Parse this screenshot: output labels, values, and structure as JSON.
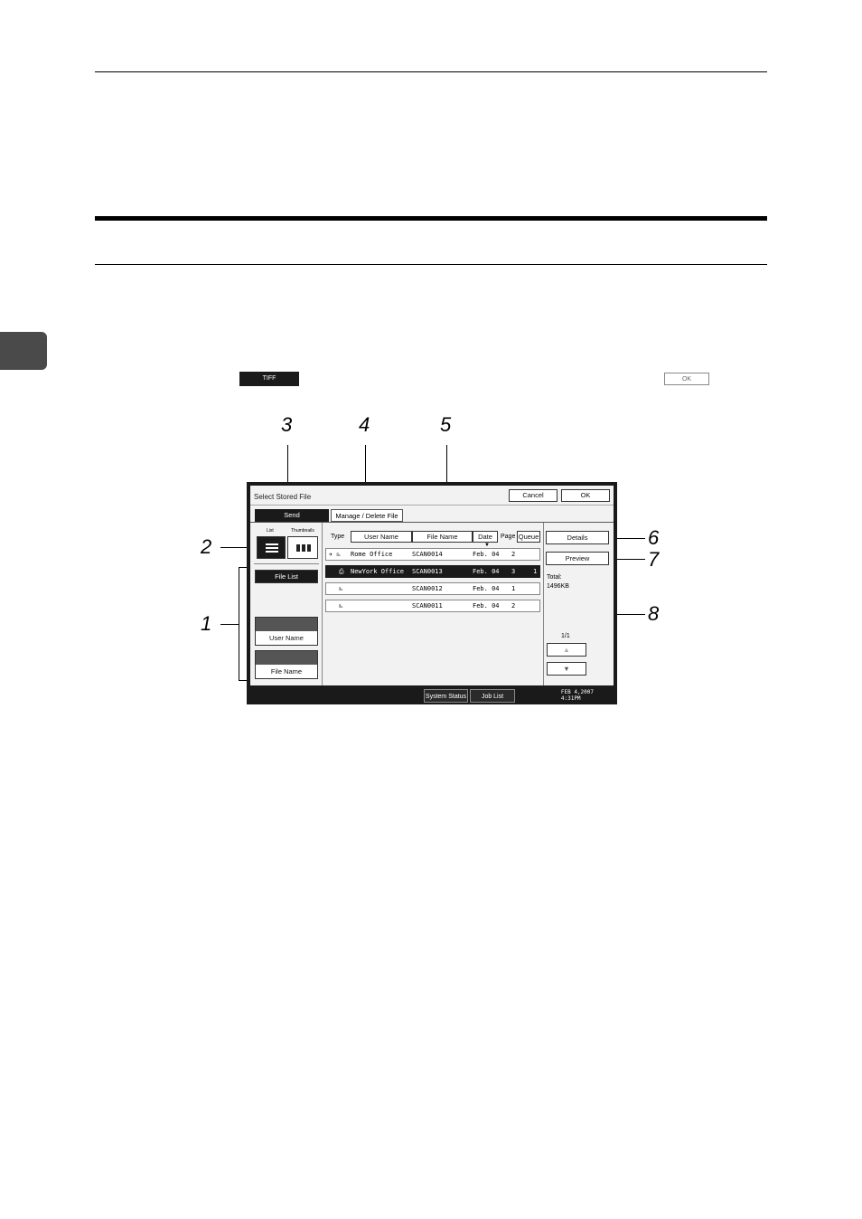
{
  "page": {
    "tiff_key": "TIFF",
    "ok_key": "OK"
  },
  "callouts": [
    "1",
    "2",
    "3",
    "4",
    "5",
    "6",
    "7",
    "8"
  ],
  "screen": {
    "title": "Select Stored File",
    "cancel": "Cancel",
    "ok": "OK",
    "tab_send": "Send",
    "tab_manage": "Manage / Delete File",
    "view_list_label": "List",
    "view_thumbnails_label": "Thumbnails",
    "file_list_label": "File List",
    "user_name_button": "User Name",
    "file_name_button": "File Name",
    "columns": {
      "type": "Type",
      "user_name": "User Name",
      "file_name": "File Name",
      "date": "Date",
      "page": "Page",
      "queue": "Queue"
    },
    "rows": [
      {
        "type_icon": "✈ ⎁",
        "user": "Rome Office",
        "file": "SCAN0014",
        "date": "Feb. 04",
        "page": "2",
        "queue": ""
      },
      {
        "type_icon": "⎙",
        "user": "NewYork Office",
        "file": "SCAN0013",
        "date": "Feb. 04",
        "page": "3",
        "queue": "1"
      },
      {
        "type_icon": "⎁",
        "user": "",
        "file": "SCAN0012",
        "date": "Feb. 04",
        "page": "1",
        "queue": ""
      },
      {
        "type_icon": "⎁",
        "user": "",
        "file": "SCAN0011",
        "date": "Feb. 04",
        "page": "2",
        "queue": ""
      }
    ],
    "details": "Details",
    "preview": "Preview",
    "total_label": "Total:",
    "total_value": "1496KB",
    "page_counter": "1/1",
    "system_status": "System Status",
    "job_list": "Job List",
    "clock_date": "FEB  4,2007",
    "clock_time": "4:31PM"
  }
}
